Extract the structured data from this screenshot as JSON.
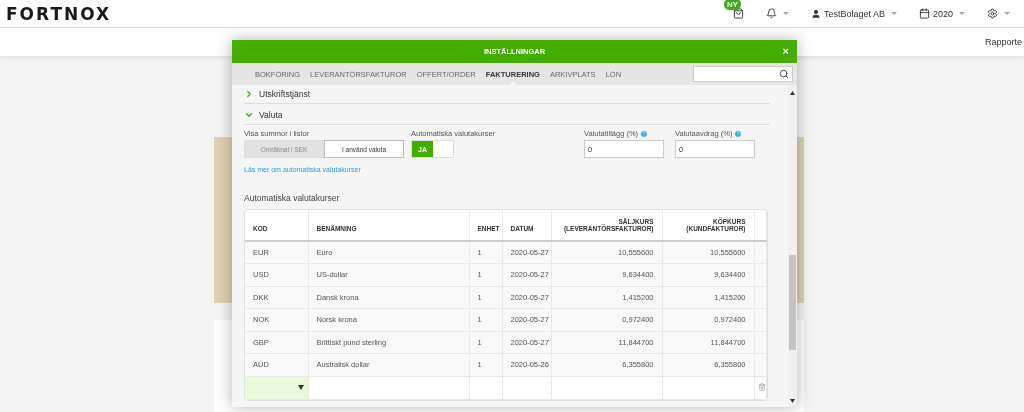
{
  "header": {
    "logo": "FORTNOX",
    "new_badge": "NY",
    "company": "TestBolaget AB",
    "year": "2020"
  },
  "subnav": {
    "link": "Rapporte"
  },
  "dialog": {
    "title": "INSTÄLLNINGAR",
    "close": "×",
    "tabs": [
      {
        "label": "BOKFÖRING",
        "selected": false
      },
      {
        "label": "LEVERANTÖRSFAKTUROR",
        "selected": false
      },
      {
        "label": "OFFERT/ORDER",
        "selected": false
      },
      {
        "label": "FAKTURERING",
        "selected": true
      },
      {
        "label": "ARKIVPLATS",
        "selected": false
      },
      {
        "label": "LÖN",
        "selected": false
      }
    ],
    "sections": [
      {
        "title": "Utskriftstjänst",
        "expanded": false
      },
      {
        "title": "Valuta",
        "expanded": true
      }
    ],
    "valuta": {
      "display_label": "Visa summor i listor",
      "display_options": [
        {
          "label": "Omräknat i SEK",
          "selected": false
        },
        {
          "label": "I använd valuta",
          "selected": true
        }
      ],
      "auto_label": "Automatiska valutakurser",
      "auto_toggle": {
        "label": "JA",
        "on": true
      },
      "surcharge": {
        "label": "Valutatillägg (%)",
        "value": "0"
      },
      "deduction": {
        "label": "Valutaavdrag (%)",
        "value": "0"
      },
      "link": "Läs mer om automatiska valutakurser"
    },
    "rates": {
      "title": "Automatiska valutakurser",
      "columns": [
        "KOD",
        "BENÄMNING",
        "ENHET",
        "DATUM",
        "SÄLJKURS (LEVERANTÖRSFAKTUROR)",
        "KÖPKURS (KUNDFAKTUROR)"
      ],
      "rows": [
        [
          "EUR",
          "Euro",
          "1",
          "2020-05-27",
          "10,555600",
          "10,555600"
        ],
        [
          "USD",
          "US-dollar",
          "1",
          "2020-05-27",
          "9,634400",
          "9,634400"
        ],
        [
          "DKK",
          "Dansk krona",
          "1",
          "2020-05-27",
          "1,415200",
          "1,415200"
        ],
        [
          "NOK",
          "Norsk krona",
          "1",
          "2020-05-27",
          "0,972400",
          "0,972400"
        ],
        [
          "GBP",
          "Brittiskt pund sterling",
          "1",
          "2020-05-27",
          "11,844700",
          "11,844700"
        ],
        [
          "AUD",
          "Australisk dollar",
          "1",
          "2020-05-26",
          "6,355800",
          "6,355800"
        ]
      ]
    }
  }
}
